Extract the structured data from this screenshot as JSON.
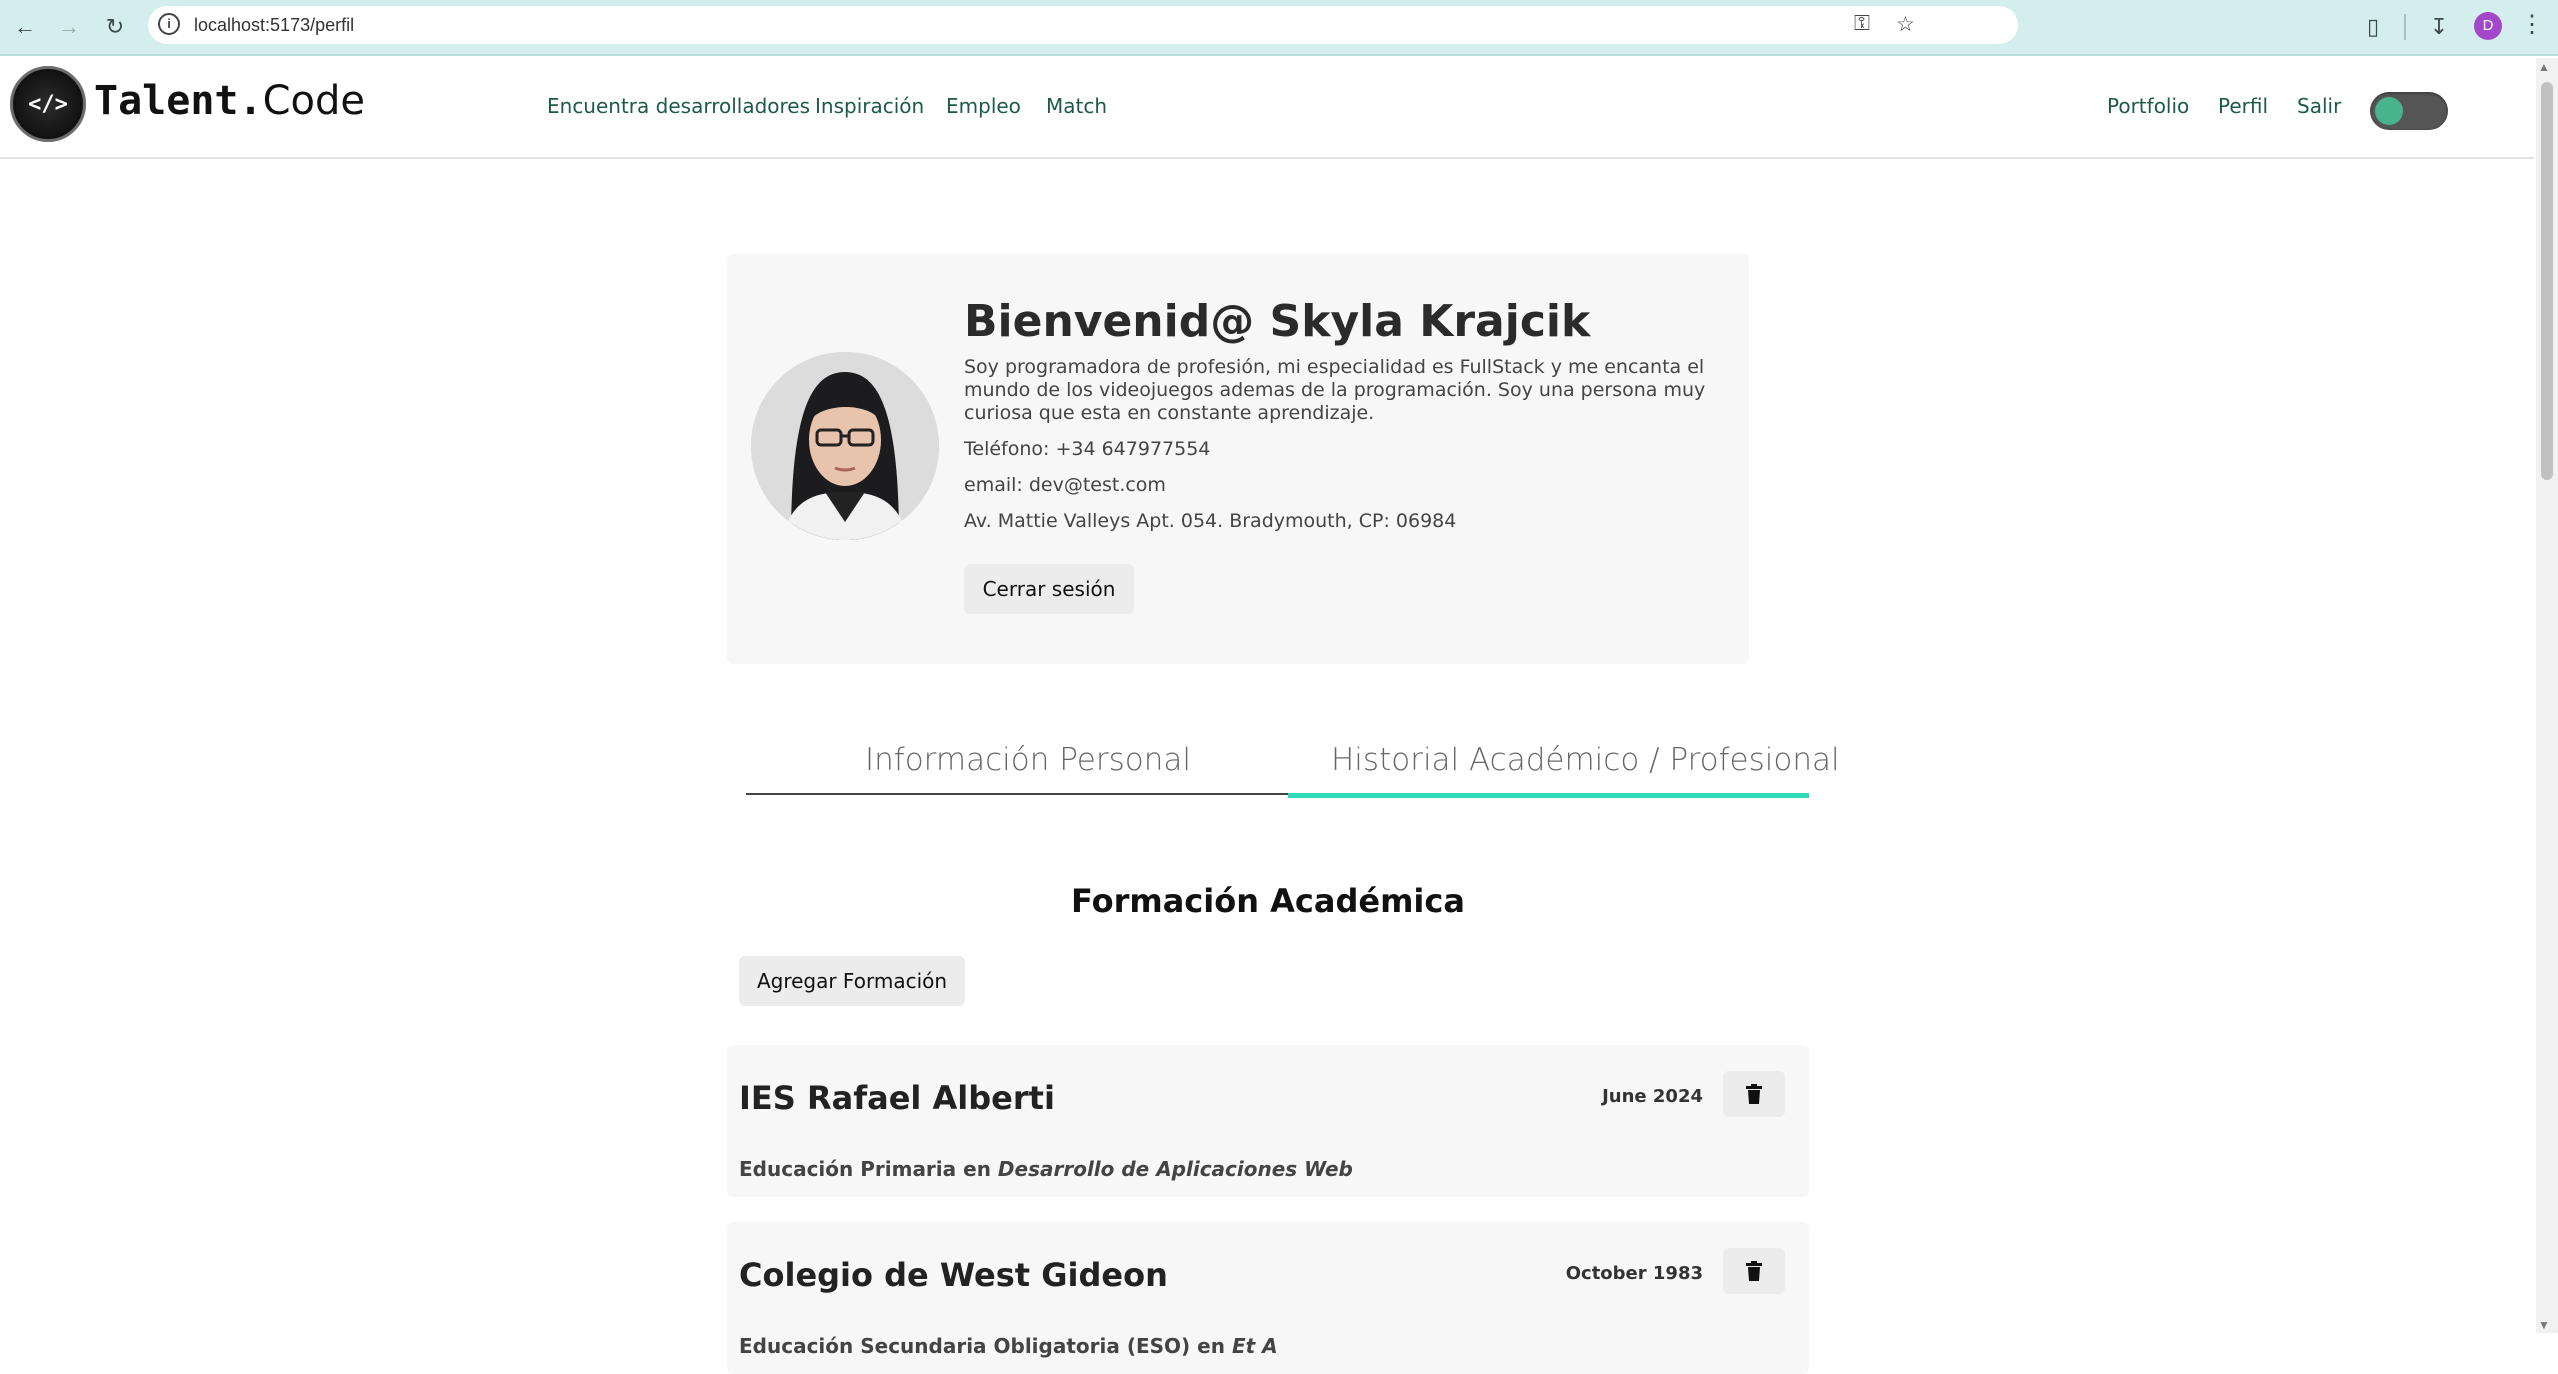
{
  "browser": {
    "url": "localhost:5173/perfil",
    "profile_initial": "D"
  },
  "header": {
    "brand_bold": "Talent",
    "brand_dot": ".",
    "brand_light": "Code",
    "logo_glyph": "</>",
    "nav_left": [
      "Encuentra desarrolladores",
      "Inspiración",
      "Empleo",
      "Match"
    ],
    "nav_right": [
      "Portfolio",
      "Perfil",
      "Salir"
    ],
    "theme_toggle": {
      "state": "off",
      "knob_color": "#48b48e"
    }
  },
  "profile": {
    "welcome": "Bienvenid@ Skyla Krajcik",
    "bio": "Soy programadora de profesión, mi especialidad es FullStack y me encanta el mundo de los videojuegos ademas de la programación. Soy una persona muy curiosa que esta en constante aprendizaje.",
    "phone": "Teléfono: +34 647977554",
    "email": "email: dev@test.com",
    "address": "Av. Mattie Valleys Apt. 054. Bradymouth, CP: 06984",
    "logout_label": "Cerrar sesión"
  },
  "tabs": [
    {
      "label": "Información Personal",
      "active": false
    },
    {
      "label": "Historial Académico / Profesional",
      "active": true
    }
  ],
  "academic": {
    "title": "Formación Académica",
    "add_label": "Agregar Formación",
    "entries": [
      {
        "institution": "IES Rafael Alberti",
        "date": "June 2024",
        "level": "Educación Primaria",
        "connector": "en",
        "field": "Desarrollo de Aplicaciones Web"
      },
      {
        "institution": "Colegio de West Gideon",
        "date": "October 1983",
        "level": "Educación Secundaria Obligatoria (ESO)",
        "connector": "en",
        "field": "Et A"
      }
    ]
  },
  "colors": {
    "accent": "#2fdcb5",
    "nav_link": "#1e5a4a",
    "chrome": "#d3eeed"
  }
}
